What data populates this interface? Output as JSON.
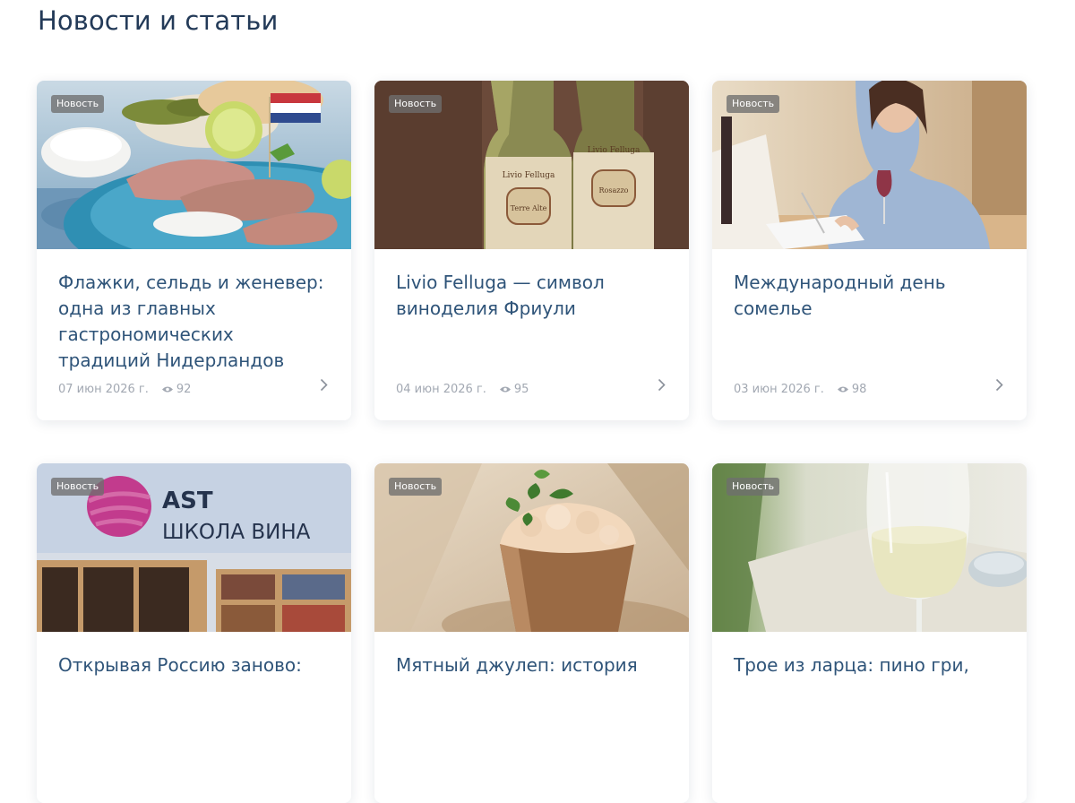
{
  "section": {
    "title": "Новости и статьи"
  },
  "cards": [
    {
      "badge": "Новость",
      "title": "Флажки, сельдь и женевер: одна из главных гастрономических традиций Нидерландов",
      "date": "07 июн 2026 г.",
      "views": "92",
      "image": "herring-plate-image"
    },
    {
      "badge": "Новость",
      "title": "Livio Felluga — символ виноделия Фриули",
      "date": "04 июн 2026 г.",
      "views": "95",
      "image": "wine-bottles-image"
    },
    {
      "badge": "Новость",
      "title": "Международный день сомелье",
      "date": "03 июн 2026 г.",
      "views": "98",
      "image": "sommelier-image"
    },
    {
      "badge": "Новость",
      "title": "Открывая Россию заново:",
      "image": "wine-school-image",
      "logo_text": [
        "AST",
        "ШКОЛА ВИНА"
      ]
    },
    {
      "badge": "Новость",
      "title": "Мятный джулеп: история",
      "image": "mint-julep-image"
    },
    {
      "badge": "Новость",
      "title": "Трое из ларца: пино гри,",
      "image": "white-wine-glass-image"
    }
  ],
  "icons": {
    "views": "eye-icon",
    "open": "chevron-right-icon"
  },
  "colors": {
    "title": "#233a58",
    "card_title": "#2f5479",
    "meta": "#a2a8b2",
    "badge_bg": "#6e6e6e"
  }
}
